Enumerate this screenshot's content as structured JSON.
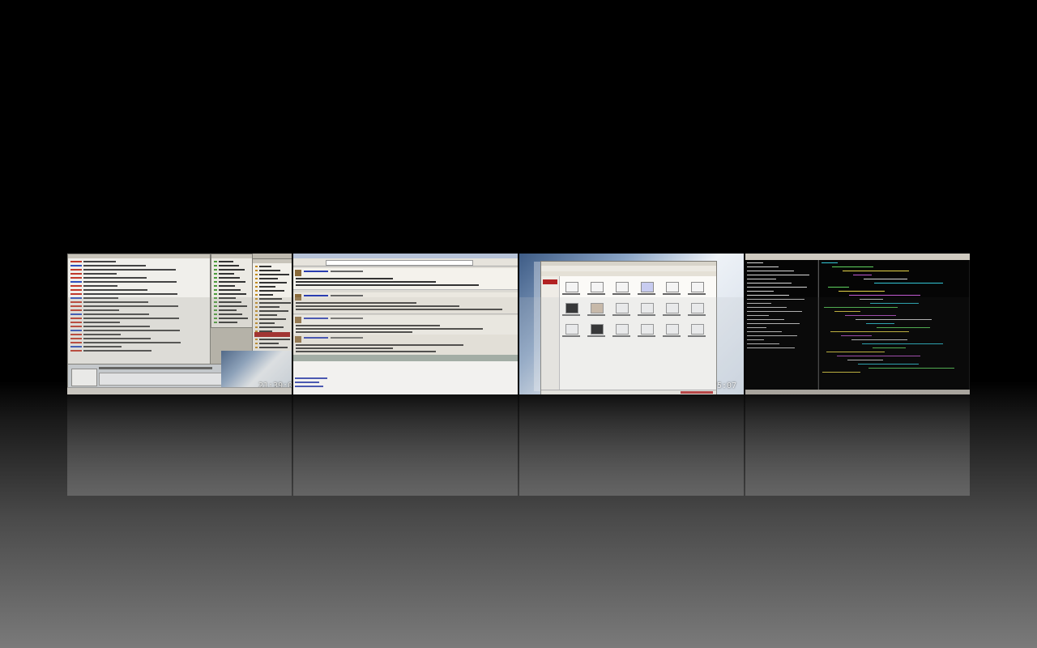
{
  "workspaces": [
    {
      "name": "workspace-1",
      "clock": "21:39:07"
    },
    {
      "name": "workspace-2",
      "clock": ""
    },
    {
      "name": "workspace-3",
      "clock": "5:07"
    },
    {
      "name": "workspace-4",
      "clock": ""
    }
  ],
  "colors": {
    "chat_nick_red": "#c0392b",
    "chat_nick_blue": "#2e4fbd",
    "terminal_bg": "#050505",
    "terminal_text": "#d8d8d8",
    "code_cyan": "#33c7d6",
    "code_green": "#5fd35f",
    "code_yellow": "#e7d64a",
    "code_magenta": "#c05ad0",
    "panel_red": "#b22222"
  },
  "icons": [
    "folder-icon",
    "file-icon",
    "image-icon",
    "terminal-icon"
  ]
}
